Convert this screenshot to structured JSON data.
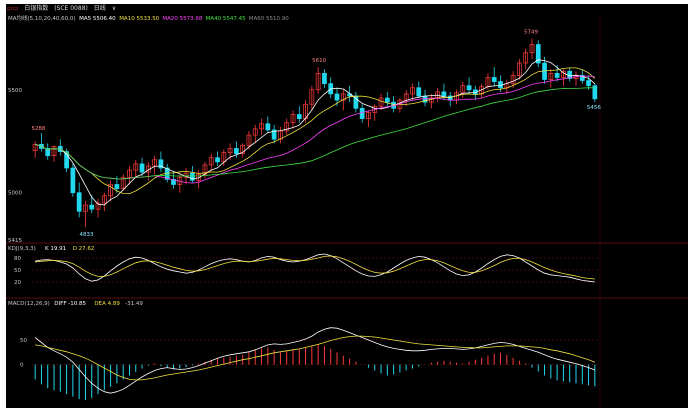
{
  "titlebar": {
    "logo": "▭▭",
    "name": "白银指数",
    "code": "(SCE 0088)",
    "period": "日线",
    "caret": "∨"
  },
  "colors": {
    "background": "#000000",
    "up": "#ff3b3b",
    "down": "#22d8ee",
    "ma5": "#ffffff",
    "ma10": "#f0e040",
    "ma30": "#ff40ff",
    "ma60": "#40e040",
    "k": "#ffffff",
    "d": "#f0e040",
    "dif": "#ffffff",
    "dea": "#f0e040",
    "grid": "#7a1010",
    "text": "#c8c8c8"
  },
  "price_panel": {
    "legend": [
      {
        "label": "MA均线(5,10,20,40,60,0)",
        "color": "#c8c8c8"
      },
      {
        "label": "MA5 5506.40",
        "color": "#ffffff"
      },
      {
        "label": "MA10 5533.50",
        "color": "#f0e040"
      },
      {
        "label": "MA20 5573.68",
        "color": "#ff40ff"
      },
      {
        "label": "MA40 5547.45",
        "color": "#40e040"
      },
      {
        "label": "MA60 5510.90",
        "color": "#8a8a8a"
      }
    ],
    "y_ticks": [
      "5500",
      "5000"
    ],
    "annotations": {
      "high_1": "5610",
      "high_2": "5749",
      "low_1": "4833",
      "left_peak": "5288",
      "last": "5456",
      "corner": "5415"
    }
  },
  "kdj_panel": {
    "legend": [
      {
        "label": "KDJ(9,3,3)",
        "color": "#c8c8c8"
      },
      {
        "label": "K 19.91",
        "color": "#ffffff"
      },
      {
        "label": "D 27.62",
        "color": "#f0e040"
      }
    ],
    "y_ticks": [
      "80",
      "50",
      "20"
    ]
  },
  "macd_panel": {
    "legend": [
      {
        "label": "MACD(12,26,9)",
        "color": "#c8c8c8"
      },
      {
        "label": "DIFF -10.85",
        "color": "#ffffff"
      },
      {
        "label": "DEA 4.89",
        "color": "#f0e040"
      },
      {
        "label": "-31.49",
        "color": "#c8c8c8"
      }
    ],
    "y_ticks": [
      "50",
      "0"
    ]
  },
  "chart_data": {
    "type": "candlestick",
    "indicators": [
      "MA",
      "KDJ",
      "MACD"
    ],
    "price_ylim": [
      4780,
      5810
    ],
    "kdj_ylim": [
      0,
      105
    ],
    "macd_ylim": [
      -80,
      115
    ],
    "candles": [
      [
        5205,
        5250,
        5170,
        5235
      ],
      [
        5235,
        5290,
        5200,
        5215
      ],
      [
        5215,
        5240,
        5160,
        5180
      ],
      [
        5180,
        5230,
        5150,
        5225
      ],
      [
        5225,
        5260,
        5180,
        5200
      ],
      [
        5200,
        5215,
        5100,
        5120
      ],
      [
        5120,
        5140,
        4980,
        5000
      ],
      [
        5000,
        5050,
        4880,
        4910
      ],
      [
        4910,
        4960,
        4833,
        4940
      ],
      [
        4940,
        4990,
        4900,
        4920
      ],
      [
        4920,
        4970,
        4880,
        4950
      ],
      [
        4950,
        5000,
        4910,
        4985
      ],
      [
        4985,
        5060,
        4960,
        5040
      ],
      [
        5040,
        5080,
        5000,
        5020
      ],
      [
        5020,
        5090,
        5010,
        5075
      ],
      [
        5075,
        5130,
        5040,
        5110
      ],
      [
        5110,
        5160,
        5070,
        5140
      ],
      [
        5140,
        5170,
        5080,
        5100
      ],
      [
        5100,
        5150,
        5060,
        5130
      ],
      [
        5130,
        5180,
        5090,
        5160
      ],
      [
        5160,
        5200,
        5100,
        5120
      ],
      [
        5120,
        5140,
        5050,
        5065
      ],
      [
        5065,
        5100,
        5020,
        5040
      ],
      [
        5040,
        5090,
        5000,
        5075
      ],
      [
        5075,
        5120,
        5040,
        5095
      ],
      [
        5095,
        5130,
        5050,
        5060
      ],
      [
        5060,
        5110,
        5020,
        5090
      ],
      [
        5090,
        5150,
        5070,
        5135
      ],
      [
        5135,
        5190,
        5110,
        5170
      ],
      [
        5170,
        5200,
        5130,
        5150
      ],
      [
        5150,
        5210,
        5130,
        5195
      ],
      [
        5195,
        5240,
        5160,
        5215
      ],
      [
        5215,
        5250,
        5170,
        5190
      ],
      [
        5190,
        5240,
        5170,
        5230
      ],
      [
        5230,
        5300,
        5210,
        5280
      ],
      [
        5280,
        5330,
        5240,
        5310
      ],
      [
        5310,
        5360,
        5280,
        5335
      ],
      [
        5335,
        5370,
        5290,
        5305
      ],
      [
        5305,
        5330,
        5240,
        5260
      ],
      [
        5260,
        5320,
        5240,
        5300
      ],
      [
        5300,
        5360,
        5280,
        5340
      ],
      [
        5340,
        5400,
        5310,
        5380
      ],
      [
        5380,
        5420,
        5340,
        5360
      ],
      [
        5360,
        5450,
        5340,
        5430
      ],
      [
        5430,
        5520,
        5400,
        5500
      ],
      [
        5500,
        5610,
        5480,
        5580
      ],
      [
        5580,
        5600,
        5510,
        5530
      ],
      [
        5530,
        5560,
        5460,
        5480
      ],
      [
        5480,
        5510,
        5420,
        5450
      ],
      [
        5450,
        5500,
        5400,
        5480
      ],
      [
        5480,
        5520,
        5440,
        5470
      ],
      [
        5470,
        5490,
        5390,
        5410
      ],
      [
        5410,
        5430,
        5340,
        5360
      ],
      [
        5360,
        5400,
        5320,
        5390
      ],
      [
        5390,
        5430,
        5350,
        5420
      ],
      [
        5420,
        5480,
        5400,
        5460
      ],
      [
        5460,
        5490,
        5420,
        5440
      ],
      [
        5440,
        5470,
        5390,
        5410
      ],
      [
        5410,
        5460,
        5390,
        5450
      ],
      [
        5450,
        5500,
        5420,
        5480
      ],
      [
        5480,
        5530,
        5450,
        5510
      ],
      [
        5510,
        5540,
        5460,
        5470
      ],
      [
        5470,
        5500,
        5420,
        5440
      ],
      [
        5440,
        5480,
        5410,
        5460
      ],
      [
        5460,
        5510,
        5440,
        5490
      ],
      [
        5490,
        5530,
        5450,
        5470
      ],
      [
        5470,
        5490,
        5420,
        5450
      ],
      [
        5450,
        5500,
        5430,
        5485
      ],
      [
        5485,
        5540,
        5460,
        5520
      ],
      [
        5520,
        5560,
        5480,
        5500
      ],
      [
        5500,
        5520,
        5450,
        5480
      ],
      [
        5480,
        5530,
        5460,
        5515
      ],
      [
        5515,
        5580,
        5500,
        5560
      ],
      [
        5560,
        5610,
        5520,
        5540
      ],
      [
        5540,
        5570,
        5490,
        5510
      ],
      [
        5510,
        5550,
        5480,
        5530
      ],
      [
        5530,
        5590,
        5510,
        5570
      ],
      [
        5570,
        5650,
        5550,
        5630
      ],
      [
        5630,
        5700,
        5600,
        5680
      ],
      [
        5680,
        5749,
        5650,
        5720
      ],
      [
        5720,
        5740,
        5610,
        5630
      ],
      [
        5630,
        5660,
        5530,
        5550
      ],
      [
        5550,
        5600,
        5510,
        5580
      ],
      [
        5580,
        5620,
        5540,
        5560
      ],
      [
        5560,
        5600,
        5520,
        5590
      ],
      [
        5590,
        5610,
        5540,
        5555
      ],
      [
        5555,
        5590,
        5520,
        5570
      ],
      [
        5570,
        5600,
        5530,
        5545
      ],
      [
        5545,
        5570,
        5500,
        5520
      ],
      [
        5520,
        5530,
        5440,
        5456
      ]
    ],
    "macd_hist": [
      -30,
      -40,
      -48,
      -52,
      -55,
      -60,
      -65,
      -70,
      -72,
      -68,
      -60,
      -52,
      -45,
      -38,
      -30,
      -22,
      -15,
      -8,
      -2,
      2,
      -3,
      -6,
      -10,
      -8,
      -5,
      -2,
      2,
      6,
      10,
      12,
      14,
      16,
      18,
      20,
      25,
      30,
      33,
      35,
      30,
      25,
      28,
      30,
      32,
      35,
      38,
      42,
      38,
      32,
      25,
      18,
      12,
      6,
      0,
      -6,
      -12,
      -18,
      -22,
      -20,
      -16,
      -12,
      -8,
      -4,
      0,
      4,
      6,
      8,
      6,
      4,
      2,
      6,
      10,
      14,
      18,
      22,
      24,
      20,
      14,
      8,
      2,
      -6,
      -14,
      -22,
      -28,
      -32,
      -34,
      -36,
      -38,
      -40,
      -42,
      -44
    ],
    "dif": [
      55,
      45,
      35,
      28,
      22,
      15,
      5,
      -10,
      -25,
      -38,
      -48,
      -55,
      -58,
      -55,
      -50,
      -42,
      -33,
      -25,
      -18,
      -12,
      -8,
      -6,
      -8,
      -10,
      -9,
      -6,
      -2,
      3,
      8,
      13,
      17,
      20,
      22,
      24,
      26,
      30,
      35,
      40,
      42,
      41,
      42,
      45,
      48,
      52,
      58,
      66,
      72,
      75,
      74,
      70,
      65,
      60,
      55,
      50,
      45,
      40,
      36,
      33,
      31,
      29,
      28,
      28,
      29,
      31,
      32,
      33,
      33,
      32,
      31,
      32,
      34,
      37,
      40,
      43,
      45,
      44,
      41,
      37,
      33,
      29,
      25,
      20,
      15,
      11,
      8,
      5,
      2,
      -2,
      -6,
      -10.85
    ],
    "dea": [
      40,
      38,
      35,
      32,
      29,
      26,
      22,
      18,
      13,
      7,
      0,
      -7,
      -14,
      -21,
      -26,
      -30,
      -31,
      -31,
      -29,
      -27,
      -24,
      -21,
      -19,
      -17,
      -15,
      -13,
      -11,
      -8,
      -5,
      -2,
      1,
      4,
      7,
      10,
      12,
      15,
      18,
      21,
      24,
      26,
      28,
      30,
      32,
      35,
      38,
      41,
      45,
      49,
      52,
      55,
      57,
      58,
      58,
      57,
      56,
      54,
      52,
      50,
      48,
      46,
      44,
      42,
      41,
      40,
      39,
      38,
      37,
      36,
      35,
      35,
      34,
      34,
      35,
      36,
      37,
      38,
      38,
      38,
      37,
      36,
      35,
      33,
      30,
      28,
      25,
      22,
      18,
      14,
      10,
      4.89
    ],
    "k": [
      72,
      75,
      76,
      74,
      70,
      65,
      55,
      40,
      28,
      22,
      25,
      35,
      48,
      60,
      70,
      78,
      82,
      80,
      74,
      66,
      58,
      52,
      48,
      45,
      42,
      44,
      50,
      58,
      66,
      72,
      76,
      78,
      76,
      72,
      70,
      74,
      80,
      84,
      82,
      76,
      72,
      70,
      72,
      76,
      82,
      88,
      90,
      86,
      78,
      68,
      58,
      48,
      40,
      35,
      34,
      38,
      45,
      55,
      65,
      74,
      80,
      84,
      82,
      76,
      68,
      58,
      48,
      40,
      36,
      38,
      45,
      55,
      66,
      76,
      84,
      88,
      86,
      80,
      70,
      60,
      50,
      42,
      38,
      36,
      34,
      32,
      28,
      24,
      22,
      19.91
    ],
    "d": [
      70,
      72,
      73,
      74,
      73,
      71,
      66,
      57,
      47,
      39,
      34,
      34,
      38,
      45,
      53,
      61,
      68,
      72,
      73,
      71,
      67,
      62,
      57,
      53,
      49,
      47,
      48,
      51,
      56,
      61,
      66,
      70,
      72,
      72,
      71,
      72,
      74,
      77,
      79,
      78,
      76,
      74,
      73,
      74,
      77,
      80,
      84,
      85,
      83,
      78,
      72,
      64,
      56,
      49,
      44,
      42,
      43,
      47,
      53,
      60,
      67,
      73,
      76,
      76,
      73,
      68,
      61,
      54,
      48,
      44,
      44,
      48,
      54,
      61,
      69,
      75,
      79,
      79,
      76,
      70,
      63,
      56,
      50,
      45,
      41,
      38,
      35,
      31,
      29,
      27.62
    ]
  }
}
